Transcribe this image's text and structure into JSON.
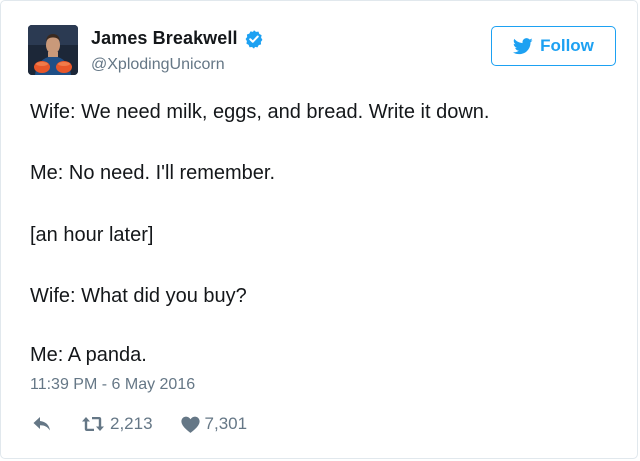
{
  "author": {
    "name": "James Breakwell",
    "handle": "@XplodingUnicorn",
    "verified": true
  },
  "follow_button": {
    "label": "Follow",
    "icon": "twitter-bird-icon",
    "color": "#1da1f2"
  },
  "tweet": {
    "lines": [
      "Wife: We need milk, eggs, and bread. Write it down.",
      "Me: No need. I'll remember.",
      "[an hour later]",
      "Wife: What did you buy?",
      "Me: A panda."
    ],
    "timestamp": "11:39 PM - 6 May 2016"
  },
  "actions": {
    "reply_icon": "reply-icon",
    "retweet_icon": "retweet-icon",
    "retweet_count": "2,213",
    "like_icon": "heart-icon",
    "like_count": "7,301"
  }
}
